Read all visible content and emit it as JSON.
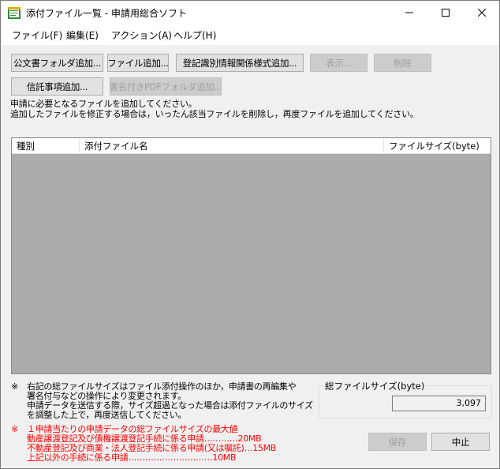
{
  "window": {
    "title": "添付ファイル一覧 - 申請用総合ソフト",
    "controls": [
      "minimize",
      "maximize",
      "close"
    ]
  },
  "menu": {
    "file": "ファイル(F)",
    "edit": "編集(E)",
    "action": "アクション(A)",
    "help": "ヘルプ(H)"
  },
  "toolbar": {
    "add_public_folder": "公文書フォルダ追加...",
    "add_file": "ファイル追加...",
    "add_registry_format": "登記識別情報関係様式追加...",
    "display": "表示...",
    "delete": "削除",
    "add_trust": "信託事項追加...",
    "add_signed_pdf_folder": "署名付きPDFフォルダ追加..."
  },
  "instructions": {
    "line1": "申請に必要となるファイルを追加してください。",
    "line2": "追加したファイルを修正する場合は，いったん該当ファイルを削除し，再度ファイルを追加してください。"
  },
  "table": {
    "columns": [
      "種別",
      "添付ファイル名",
      "ファイルサイズ(byte)"
    ],
    "rows": []
  },
  "note1": {
    "mark": "※",
    "lines": [
      "右記の総ファイルサイズはファイル添付操作のほか，申請書の再編集や",
      "署名付与などの操作により変更されます。",
      "申請データを送信する際，サイズ超過となった場合は添付ファイルのサイズ",
      "を調整した上で，再度送信してください。"
    ]
  },
  "note2": {
    "mark": "※",
    "lines": [
      "１申請当たりの申請データの総ファイルサイズの最大値",
      "動産譲渡登記及び債権譲渡登記手続に係る申請…………20MB",
      "不動産登記及び商業・法人登記手続に係る申請(又は嘱託)…15MB",
      "上記以外の手続に係る申請…………………………10MB"
    ]
  },
  "total": {
    "label": "総ファイルサイズ(byte)",
    "value": "3,097"
  },
  "buttons": {
    "save": "保存",
    "cancel": "中止"
  },
  "colors": {
    "warning_text": "#ff0000",
    "list_background": "#ababab"
  }
}
